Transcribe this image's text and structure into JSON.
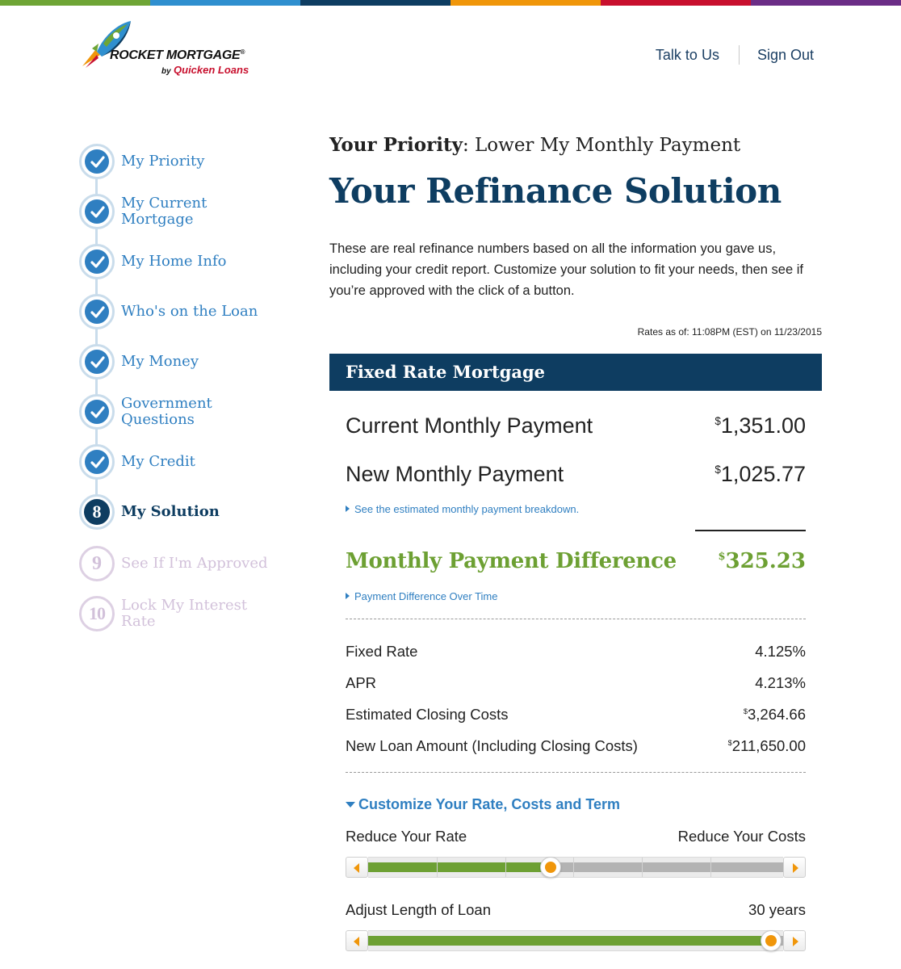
{
  "brand": {
    "name": "ROCKET MORTGAGE",
    "tm": "®",
    "by": "by",
    "parent": "Quicken Loans",
    "topbar_colors": [
      "#6ea535",
      "#2f8fcf",
      "#0e3d61",
      "#f0960a",
      "#c8102e",
      "#6b2d86"
    ]
  },
  "topnav": {
    "talk": "Talk to Us",
    "signout": "Sign Out"
  },
  "steps": [
    {
      "label": "My Priority",
      "state": "done"
    },
    {
      "label": "My Current Mortgage",
      "state": "done"
    },
    {
      "label": "My Home Info",
      "state": "done"
    },
    {
      "label": "Who's on the Loan",
      "state": "done"
    },
    {
      "label": "My Money",
      "state": "done"
    },
    {
      "label": "Government Questions",
      "state": "done"
    },
    {
      "label": "My Credit",
      "state": "done"
    },
    {
      "label": "My Solution",
      "state": "current",
      "number": "8"
    },
    {
      "label": "See If I'm Approved",
      "state": "future",
      "number": "9"
    },
    {
      "label": "Lock My Interest Rate",
      "state": "future",
      "number": "10"
    }
  ],
  "header": {
    "priority_label": "Your Priority",
    "priority_value": ": Lower My Monthly Payment",
    "title": "Your Refinance Solution",
    "intro": "These are real refinance numbers based on all the information you gave us, including your credit report. Customize your solution to fit your needs, then see if you’re approved with the click of a button.",
    "rates_asof": "Rates as of: 11:08PM (EST) on 11/23/2015"
  },
  "panel": {
    "title": "Fixed Rate Mortgage",
    "current_label": "Current Monthly Payment",
    "current_currency": "$",
    "current_value": "1,351.00",
    "new_label": "New Monthly Payment",
    "new_currency": "$",
    "new_value": "1,025.77",
    "breakdown_link": "See the estimated monthly payment breakdown.",
    "diff_label": "Monthly Payment Difference",
    "diff_currency": "$",
    "diff_value": "325.23",
    "diff_link": "Payment Difference Over Time",
    "details": [
      {
        "label": "Fixed Rate",
        "currency": "",
        "value": "4.125%"
      },
      {
        "label": "APR",
        "currency": "",
        "value": "4.213%"
      },
      {
        "label": "Estimated Closing Costs",
        "currency": "$",
        "value": "3,264.66"
      },
      {
        "label": "New Loan Amount (Including Closing Costs)",
        "currency": "$",
        "value": "211,650.00"
      }
    ]
  },
  "customize": {
    "toggle": "Customize Your Rate, Costs and Term",
    "rate_left": "Reduce Your Rate",
    "rate_right": "Reduce Your Costs",
    "rate_slider_fraction": 0.44,
    "term_label": "Adjust Length of Loan",
    "term_value": "30 years",
    "term_slider_fraction": 0.97
  }
}
